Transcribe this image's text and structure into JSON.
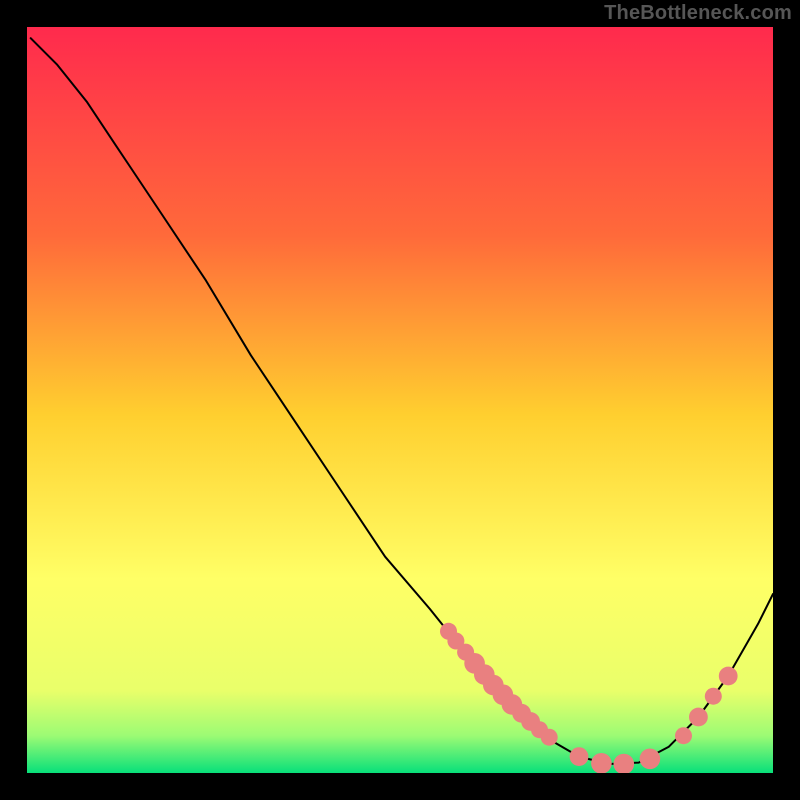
{
  "attribution": "TheBottleneck.com",
  "chart_data": {
    "type": "line",
    "title": "",
    "xlabel": "",
    "ylabel": "",
    "x_range": [
      0,
      100
    ],
    "y_range": [
      0,
      100
    ],
    "background_gradient": {
      "stops": [
        {
          "offset": 0,
          "color": "#ff2a4d"
        },
        {
          "offset": 28,
          "color": "#ff6a3a"
        },
        {
          "offset": 52,
          "color": "#ffcf2f"
        },
        {
          "offset": 74,
          "color": "#ffff66"
        },
        {
          "offset": 89,
          "color": "#e9ff6a"
        },
        {
          "offset": 95,
          "color": "#9cfb74"
        },
        {
          "offset": 100,
          "color": "#08e07a"
        }
      ]
    },
    "curve": [
      {
        "x": 0.5,
        "y": 98.5
      },
      {
        "x": 4,
        "y": 95
      },
      {
        "x": 8,
        "y": 90
      },
      {
        "x": 12,
        "y": 84
      },
      {
        "x": 18,
        "y": 75
      },
      {
        "x": 24,
        "y": 66
      },
      {
        "x": 30,
        "y": 56
      },
      {
        "x": 36,
        "y": 47
      },
      {
        "x": 42,
        "y": 38
      },
      {
        "x": 48,
        "y": 29
      },
      {
        "x": 54,
        "y": 22
      },
      {
        "x": 58,
        "y": 17
      },
      {
        "x": 62,
        "y": 12
      },
      {
        "x": 66,
        "y": 8
      },
      {
        "x": 70,
        "y": 4.5
      },
      {
        "x": 74,
        "y": 2.2
      },
      {
        "x": 78,
        "y": 1.2
      },
      {
        "x": 82,
        "y": 1.4
      },
      {
        "x": 86,
        "y": 3.5
      },
      {
        "x": 90,
        "y": 7.5
      },
      {
        "x": 94,
        "y": 13
      },
      {
        "x": 98,
        "y": 20
      },
      {
        "x": 100,
        "y": 24
      }
    ],
    "markers": [
      {
        "x": 56.5,
        "y": 19,
        "r": 1.0
      },
      {
        "x": 57.5,
        "y": 17.7,
        "r": 1.0
      },
      {
        "x": 58.8,
        "y": 16.2,
        "r": 1.0
      },
      {
        "x": 60.0,
        "y": 14.7,
        "r": 1.4
      },
      {
        "x": 61.3,
        "y": 13.2,
        "r": 1.4
      },
      {
        "x": 62.5,
        "y": 11.8,
        "r": 1.4
      },
      {
        "x": 63.8,
        "y": 10.5,
        "r": 1.4
      },
      {
        "x": 65.0,
        "y": 9.2,
        "r": 1.4
      },
      {
        "x": 66.3,
        "y": 8.0,
        "r": 1.2
      },
      {
        "x": 67.5,
        "y": 6.9,
        "r": 1.2
      },
      {
        "x": 68.7,
        "y": 5.8,
        "r": 1.0
      },
      {
        "x": 70.0,
        "y": 4.8,
        "r": 1.0
      },
      {
        "x": 74.0,
        "y": 2.2,
        "r": 1.2
      },
      {
        "x": 77.0,
        "y": 1.3,
        "r": 1.4
      },
      {
        "x": 80.0,
        "y": 1.2,
        "r": 1.4
      },
      {
        "x": 83.5,
        "y": 1.9,
        "r": 1.4
      },
      {
        "x": 88.0,
        "y": 5.0,
        "r": 1.0
      },
      {
        "x": 90.0,
        "y": 7.5,
        "r": 1.2
      },
      {
        "x": 92.0,
        "y": 10.3,
        "r": 1.0
      },
      {
        "x": 94.0,
        "y": 13.0,
        "r": 1.2
      }
    ],
    "marker_color": "#e98080",
    "curve_color": "#000000",
    "curve_width": 2
  }
}
